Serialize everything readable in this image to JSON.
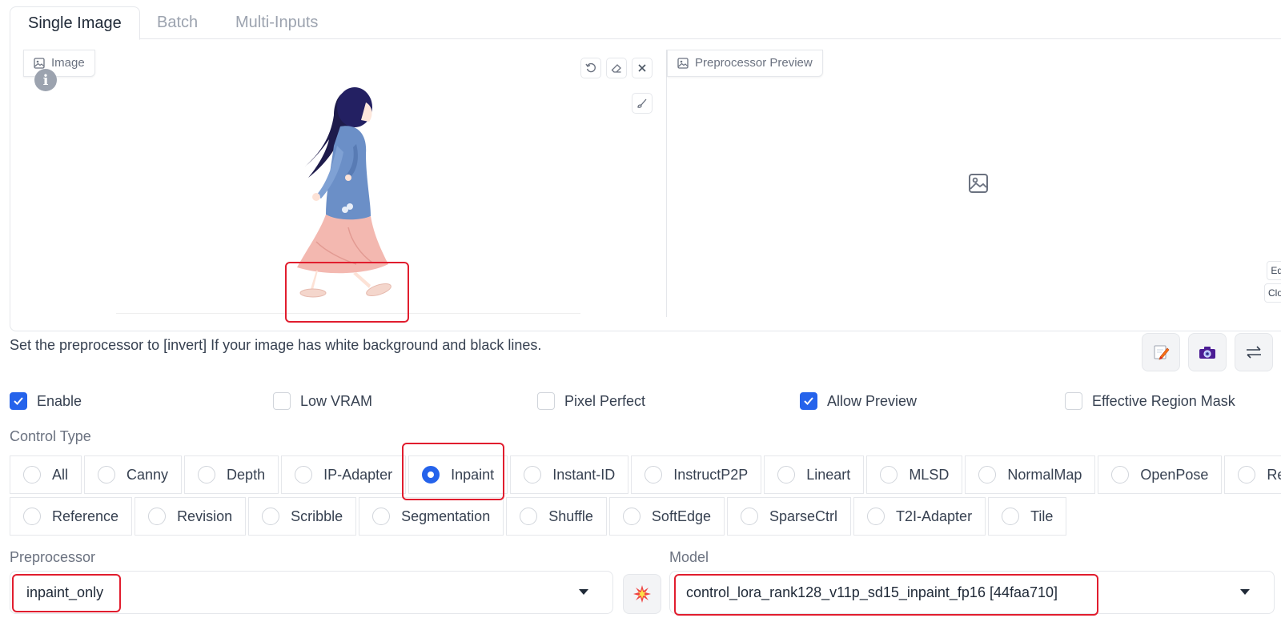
{
  "tabs": [
    "Single Image",
    "Batch",
    "Multi-Inputs"
  ],
  "image_panel": {
    "label": "Image"
  },
  "preview_panel": {
    "label": "Preprocessor Preview",
    "side_buttons": [
      "Edit",
      "Clos"
    ]
  },
  "hint": "Set the preprocessor to [invert] If your image has white background and black lines.",
  "action_icons": [
    "edit-icon",
    "camera-icon",
    "swap-icon"
  ],
  "checkboxes": [
    {
      "label": "Enable",
      "checked": true
    },
    {
      "label": "Low VRAM",
      "checked": false
    },
    {
      "label": "Pixel Perfect",
      "checked": false
    },
    {
      "label": "Allow Preview",
      "checked": true
    },
    {
      "label": "Effective Region Mask",
      "checked": false
    }
  ],
  "control_type": {
    "label": "Control Type",
    "row1": [
      "All",
      "Canny",
      "Depth",
      "IP-Adapter",
      "Inpaint",
      "Instant-ID",
      "InstructP2P",
      "Lineart",
      "MLSD",
      "NormalMap",
      "OpenPose",
      "Recol"
    ],
    "row2": [
      "Reference",
      "Revision",
      "Scribble",
      "Segmentation",
      "Shuffle",
      "SoftEdge",
      "SparseCtrl",
      "T2I-Adapter",
      "Tile"
    ],
    "selected": "Inpaint"
  },
  "preprocessor": {
    "label": "Preprocessor",
    "value": "inpaint_only"
  },
  "model": {
    "label": "Model",
    "value": "control_lora_rank128_v11p_sd15_inpaint_fp16 [44faa710]"
  },
  "colors": {
    "accent": "#2563eb",
    "highlight": "#e11d2e"
  }
}
